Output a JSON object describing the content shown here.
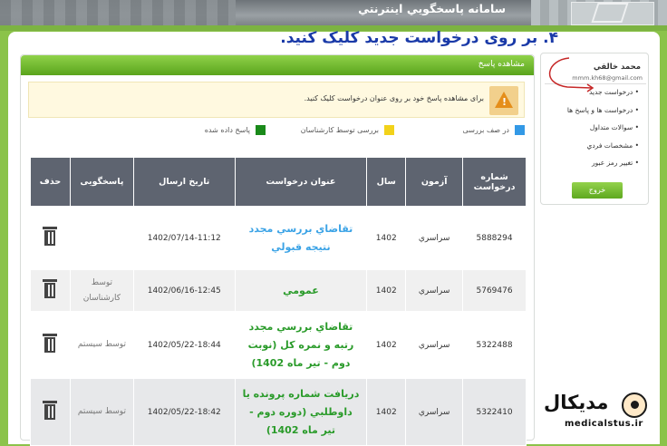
{
  "header": {
    "system_title": "سامانه پاسخگويي اينترنتي"
  },
  "instruction": "۴. بر روی درخواست جدید کلیک کنید.",
  "main": {
    "panel_title": "مشاهده پاسخ",
    "notice": "برای مشاهده پاسخ خود بر روی عنوان درخواست کليک کنيد.",
    "legend": [
      {
        "label": "در صف بررسی",
        "color": "#3399e6"
      },
      {
        "label": "بررسی توسط کارشناسان",
        "color": "#f2d21a"
      },
      {
        "label": "پاسخ داده شده",
        "color": "#1a8a1a"
      }
    ],
    "table": {
      "headers": [
        "شماره درخواست",
        "آزمون",
        "سال",
        "عنوان درخواست",
        "تاريخ ارسال",
        "پاسخگويی",
        "حذف"
      ],
      "rows": [
        {
          "id": "5888294",
          "exam": "سراسري",
          "year": "1402",
          "subject": "تقاضاي بررسي مجدد نتيجه قبولي",
          "date": "1402/07/14-11:12",
          "responder": ""
        },
        {
          "id": "5769476",
          "exam": "سراسري",
          "year": "1402",
          "subject": "عمومي",
          "date": "1402/06/16-12:45",
          "responder": "توسط کارشناسان"
        },
        {
          "id": "5322488",
          "exam": "سراسري",
          "year": "1402",
          "subject": "تقاضاي بررسي مجدد رتبه و نمره کل (نوبت دوم - تير ماه 1402)",
          "date": "1402/05/22-18:44",
          "responder": "توسط سيستم"
        },
        {
          "id": "5322410",
          "exam": "سراسري",
          "year": "1402",
          "subject": "دريافت شماره پرونده يا داوطلبي (دوره دوم - تير ماه 1402)",
          "date": "1402/05/22-18:42",
          "responder": "توسط سيستم"
        }
      ]
    }
  },
  "side": {
    "name": "محمد خالقي",
    "email": "mmm.kh68@gmail.com",
    "menu": [
      "درخواست جديد",
      "درخواست ها و پاسخ ها",
      "سوالات متداول",
      "مشخصات فردي",
      "تغيير رمز عبور"
    ],
    "logout": "خروج"
  },
  "watermark": {
    "brand": "مدیکال",
    "url": "medicalstus.ir"
  }
}
